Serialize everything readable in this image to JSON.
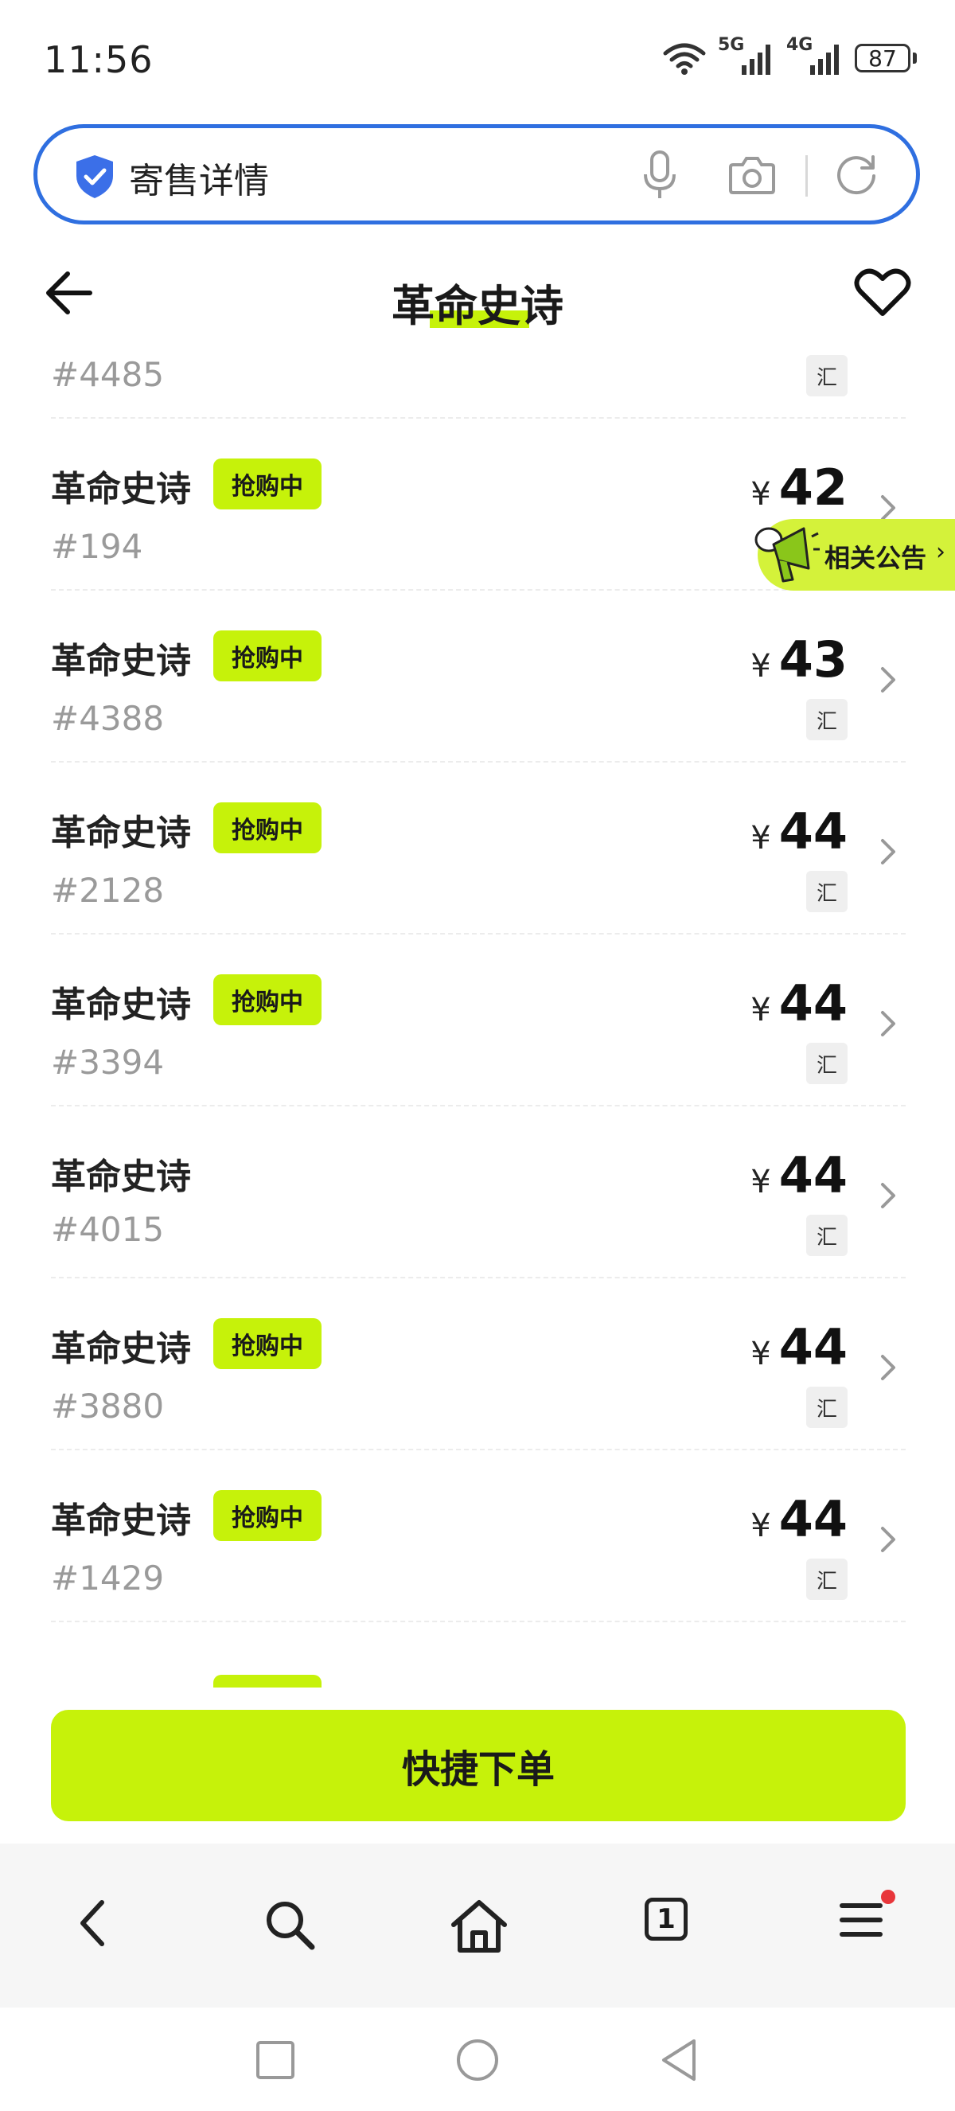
{
  "status_bar": {
    "time": "11:56",
    "net1": "5G",
    "net2": "4G",
    "battery": "87"
  },
  "address_bar": {
    "text": "寄售详情"
  },
  "header": {
    "title": "革命史诗"
  },
  "partial_top_row": {
    "number": "#4485",
    "tag": "汇"
  },
  "rows": [
    {
      "name": "革命史诗",
      "badge": "抢购中",
      "number": "#194",
      "yen": "¥",
      "price": "42",
      "tag": "汇"
    },
    {
      "name": "革命史诗",
      "badge": "抢购中",
      "number": "#4388",
      "yen": "¥",
      "price": "43",
      "tag": "汇"
    },
    {
      "name": "革命史诗",
      "badge": "抢购中",
      "number": "#2128",
      "yen": "¥",
      "price": "44",
      "tag": "汇"
    },
    {
      "name": "革命史诗",
      "badge": "抢购中",
      "number": "#3394",
      "yen": "¥",
      "price": "44",
      "tag": "汇"
    },
    {
      "name": "革命史诗",
      "badge": "",
      "number": "#4015",
      "yen": "¥",
      "price": "44",
      "tag": "汇"
    },
    {
      "name": "革命史诗",
      "badge": "抢购中",
      "number": "#3880",
      "yen": "¥",
      "price": "44",
      "tag": "汇"
    },
    {
      "name": "革命史诗",
      "badge": "抢购中",
      "number": "#1429",
      "yen": "¥",
      "price": "44",
      "tag": "汇"
    }
  ],
  "announcement": {
    "label": "相关公告",
    "arrow": "›"
  },
  "quick_order": {
    "label": "快捷下单"
  },
  "browser_bar": {
    "tab_count": "1"
  },
  "colors": {
    "accent": "#c6f20a",
    "address_border": "#2f6fe0",
    "shield": "#3b6fe8",
    "notify": "#e8363b"
  }
}
